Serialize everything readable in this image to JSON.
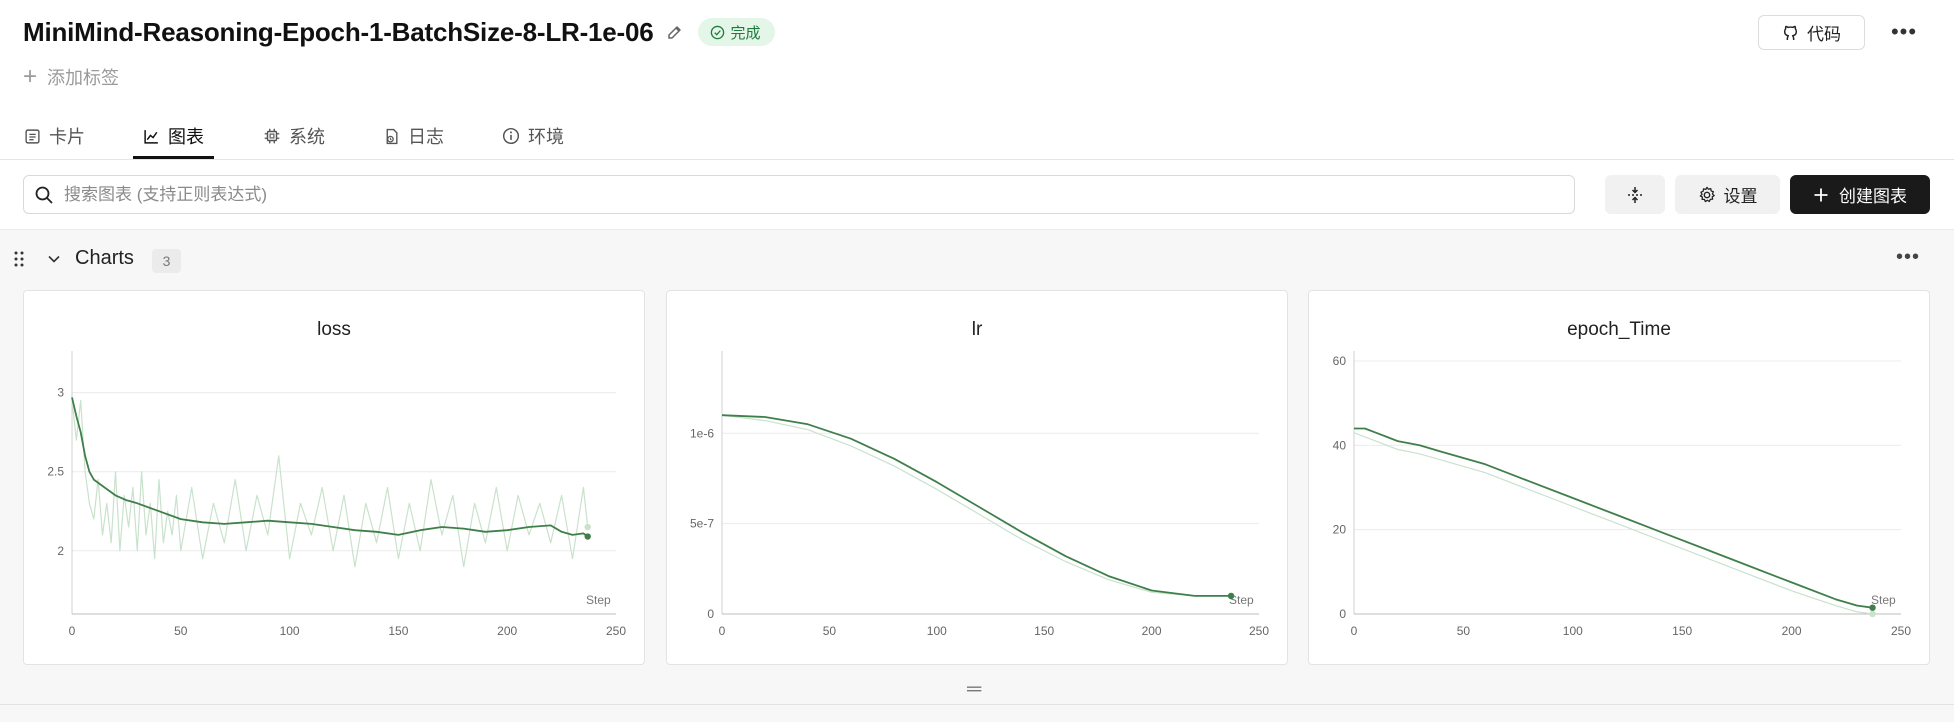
{
  "header": {
    "title": "MiniMind-Reasoning-Epoch-1-BatchSize-8-LR-1e-06",
    "status": "完成",
    "code_button": "代码",
    "add_tag": "添加标签"
  },
  "tabs": [
    {
      "label": "卡片",
      "icon": "card-icon"
    },
    {
      "label": "图表",
      "icon": "chart-icon",
      "active": true
    },
    {
      "label": "系统",
      "icon": "chip-icon"
    },
    {
      "label": "日志",
      "icon": "log-icon"
    },
    {
      "label": "环境",
      "icon": "info-icon"
    }
  ],
  "toolbar": {
    "search_placeholder": "搜索图表 (支持正则表达式)",
    "settings_label": "设置",
    "create_label": "创建图表"
  },
  "group": {
    "title": "Charts",
    "count": "3"
  },
  "colors": {
    "line": "#3f7f4a",
    "line_light": "#c9e2cc",
    "status_bg": "#e3f6e8",
    "status_fg": "#1e7a3a"
  },
  "chart_data": [
    {
      "type": "line",
      "title": "loss",
      "xlabel": "Step",
      "ylabel": "",
      "xlim": [
        0,
        250
      ],
      "ylim": [
        1.6,
        3.2
      ],
      "x_ticks": [
        "0",
        "50",
        "100",
        "150",
        "200",
        "250"
      ],
      "y_ticks": [
        {
          "v": 2,
          "label": "2"
        },
        {
          "v": 2.5,
          "label": "2.5"
        },
        {
          "v": 3,
          "label": "3"
        }
      ],
      "series": [
        {
          "role": "smoothed",
          "x": [
            0,
            2,
            4,
            6,
            8,
            10,
            15,
            20,
            25,
            30,
            40,
            50,
            60,
            70,
            80,
            90,
            100,
            110,
            120,
            130,
            140,
            150,
            160,
            170,
            180,
            190,
            200,
            210,
            220,
            225,
            230,
            235,
            237
          ],
          "values": [
            2.97,
            2.85,
            2.75,
            2.6,
            2.5,
            2.45,
            2.4,
            2.35,
            2.32,
            2.3,
            2.25,
            2.2,
            2.18,
            2.17,
            2.18,
            2.19,
            2.18,
            2.17,
            2.15,
            2.13,
            2.12,
            2.1,
            2.13,
            2.15,
            2.14,
            2.12,
            2.13,
            2.15,
            2.16,
            2.12,
            2.1,
            2.11,
            2.09
          ]
        },
        {
          "role": "raw",
          "x": [
            0,
            2,
            4,
            6,
            8,
            10,
            12,
            14,
            16,
            18,
            20,
            22,
            24,
            26,
            28,
            30,
            32,
            34,
            36,
            38,
            40,
            42,
            44,
            46,
            48,
            50,
            55,
            60,
            65,
            70,
            75,
            80,
            85,
            90,
            95,
            100,
            105,
            110,
            115,
            120,
            125,
            130,
            135,
            140,
            145,
            150,
            155,
            160,
            165,
            170,
            175,
            180,
            185,
            190,
            195,
            200,
            205,
            210,
            215,
            220,
            225,
            230,
            235,
            237
          ],
          "values": [
            2.95,
            2.7,
            2.95,
            2.5,
            2.3,
            2.2,
            2.45,
            2.1,
            2.3,
            2.05,
            2.5,
            2.0,
            2.35,
            2.15,
            2.4,
            2.0,
            2.5,
            2.1,
            2.3,
            1.95,
            2.45,
            2.05,
            2.25,
            2.1,
            2.35,
            2.0,
            2.4,
            1.95,
            2.3,
            2.05,
            2.45,
            2.0,
            2.35,
            2.1,
            2.6,
            1.95,
            2.3,
            2.1,
            2.4,
            2.0,
            2.35,
            1.9,
            2.3,
            2.05,
            2.4,
            1.95,
            2.3,
            2.0,
            2.45,
            2.1,
            2.35,
            1.9,
            2.3,
            2.05,
            2.4,
            2.0,
            2.35,
            2.1,
            2.3,
            2.05,
            2.35,
            1.95,
            2.4,
            2.15
          ]
        }
      ]
    },
    {
      "type": "line",
      "title": "lr",
      "xlabel": "Step",
      "ylabel": "",
      "xlim": [
        0,
        250
      ],
      "ylim": [
        0,
        1.4e-06
      ],
      "x_ticks": [
        "0",
        "50",
        "100",
        "150",
        "200",
        "250"
      ],
      "y_ticks": [
        {
          "v": 0,
          "label": "0"
        },
        {
          "v": 5e-07,
          "label": "5e-7"
        },
        {
          "v": 1e-06,
          "label": "1e-6"
        }
      ],
      "series": [
        {
          "role": "smoothed",
          "x": [
            0,
            20,
            40,
            60,
            80,
            100,
            120,
            140,
            160,
            180,
            200,
            220,
            237
          ],
          "values": [
            1.1e-06,
            1.09e-06,
            1.05e-06,
            9.7e-07,
            8.6e-07,
            7.3e-07,
            5.9e-07,
            4.5e-07,
            3.2e-07,
            2.1e-07,
            1.3e-07,
            1e-07,
            1e-07
          ]
        },
        {
          "role": "raw",
          "x": [
            0,
            20,
            40,
            60,
            80,
            100,
            120,
            140,
            160,
            180,
            200,
            220,
            237
          ],
          "values": [
            1.1e-06,
            1.07e-06,
            1.02e-06,
            9.3e-07,
            8.2e-07,
            6.9e-07,
            5.5e-07,
            4.1e-07,
            2.9e-07,
            1.9e-07,
            1.2e-07,
            1e-07,
            1e-07
          ]
        }
      ]
    },
    {
      "type": "line",
      "title": "epoch_Time",
      "xlabel": "Step",
      "ylabel": "",
      "xlim": [
        0,
        250
      ],
      "ylim": [
        0,
        60
      ],
      "x_ticks": [
        "0",
        "50",
        "100",
        "150",
        "200",
        "250"
      ],
      "y_ticks": [
        {
          "v": 0,
          "label": "0"
        },
        {
          "v": 20,
          "label": "20"
        },
        {
          "v": 40,
          "label": "40"
        },
        {
          "v": 60,
          "label": "60"
        }
      ],
      "series": [
        {
          "role": "smoothed",
          "x": [
            0,
            5,
            10,
            15,
            20,
            30,
            40,
            50,
            60,
            80,
            100,
            120,
            140,
            160,
            180,
            200,
            220,
            230,
            237
          ],
          "values": [
            44,
            44,
            43,
            42,
            41,
            40,
            38.5,
            37,
            35.5,
            31.5,
            27.5,
            23.5,
            19.5,
            15.5,
            11.5,
            7.5,
            3.5,
            2,
            1.5
          ]
        },
        {
          "role": "raw",
          "x": [
            0,
            5,
            10,
            15,
            20,
            30,
            40,
            50,
            60,
            80,
            100,
            120,
            140,
            160,
            180,
            200,
            220,
            230,
            237
          ],
          "values": [
            43,
            42,
            41,
            40,
            39,
            38,
            36.5,
            35,
            33.5,
            29.5,
            25.5,
            21.5,
            17.5,
            13.5,
            9.5,
            5.5,
            2,
            0.5,
            0
          ]
        }
      ]
    }
  ]
}
